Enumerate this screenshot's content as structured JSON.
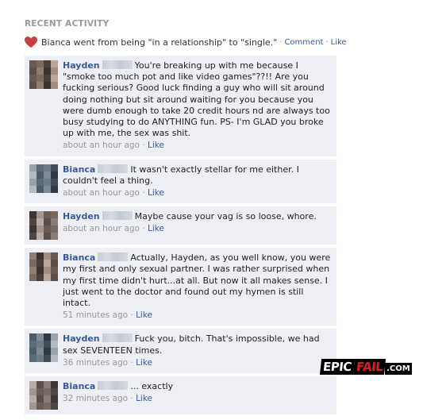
{
  "activity": {
    "header": "RECENT ACTIVITY",
    "status_text": "Bianca went from being \"in a relationship\" to \"single.\"",
    "sep": "·",
    "comment_link": "Comment",
    "like_link": "Like"
  },
  "comments": [
    {
      "name": "Hayden",
      "text": "You're breaking up with me because I \"smoke too much pot and like video games\"??!! Are you fucking serious? Good luck finding a guy who will sit around doing nothing but sit around waiting for you because you were dumb enough to take 20 credit hours nd are always too busy studying to do ANYTHING fun. PS- I'm GLAD you broke up with me, the sex was shit.",
      "time": "about an hour ago",
      "like": "Like"
    },
    {
      "name": "Bianca",
      "text": "It wasn't exactly stellar for me either. I couldn't feel a thing.",
      "time": "about an hour ago",
      "like": "Like"
    },
    {
      "name": "Hayden",
      "text": "Maybe cause your vag is so loose, whore.",
      "time": "about an hour ago",
      "like": "Like"
    },
    {
      "name": "Bianca",
      "text": "Actually, Hayden, as you well know, you were my first and only sexual partner. I was rather surprised when my first time didn't hurt...at all. But now it all makes sense. I just went to the doctor and found out my hymen is still intact.",
      "time": "51 minutes ago",
      "like": "Like"
    },
    {
      "name": "Hayden",
      "text": "Fuck you, bitch. That's impossible, we had sex SEVENTEEN times.",
      "time": "36 minutes ago",
      "like": "Like"
    },
    {
      "name": "Bianca",
      "text": "... exactly",
      "time": "32 minutes ago",
      "like": "Like"
    }
  ],
  "watermark": {
    "epic": "EPIC",
    "fail": "FAIL",
    "com": ".COM"
  },
  "colors": {
    "link": "#3b5998",
    "comment_bg": "#edeff4",
    "heart": "#d9534f"
  }
}
